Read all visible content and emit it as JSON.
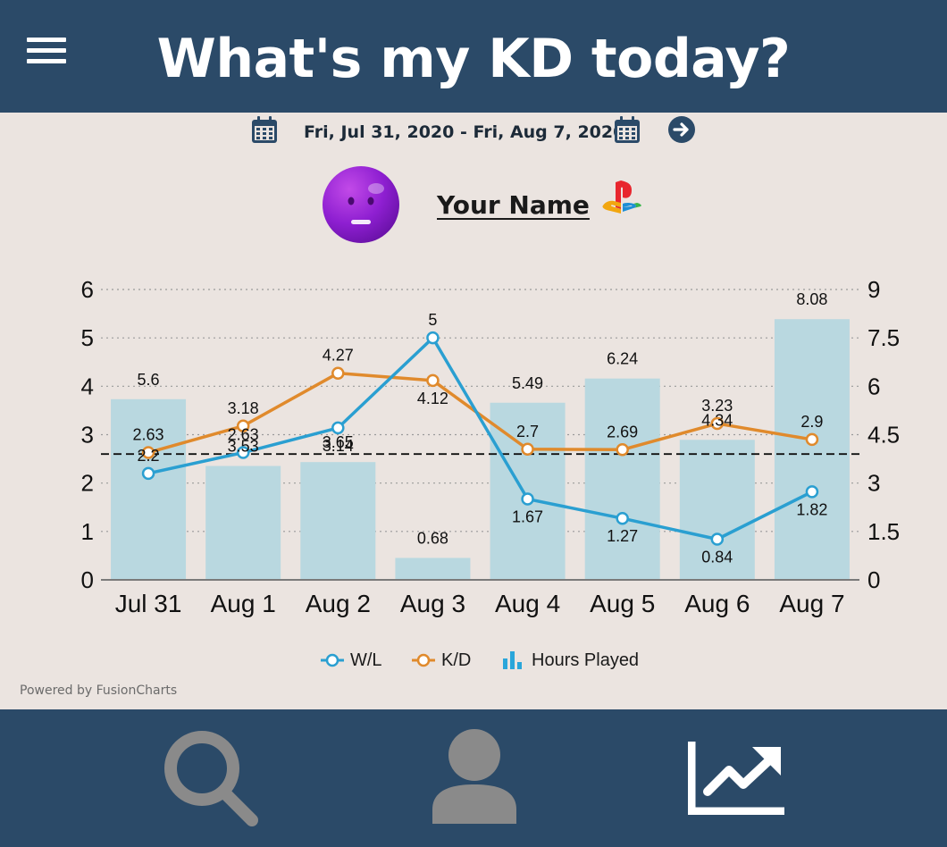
{
  "header": {
    "title": "What's my KD today?",
    "menu_icon": "hamburger-menu-icon"
  },
  "date_range": {
    "label": "Fri, Jul 31, 2020 - Fri, Aug 7, 2020",
    "start_icon": "calendar-icon",
    "end_icon": "calendar-icon",
    "next_icon": "arrow-right-circle-icon"
  },
  "profile": {
    "name": "Your Name",
    "avatar_icon": "neutral-face-avatar",
    "platform_icon": "playstation-logo-icon"
  },
  "chart_data": {
    "type": "combo",
    "categories": [
      "Jul 31",
      "Aug 1",
      "Aug 2",
      "Aug 3",
      "Aug 4",
      "Aug 5",
      "Aug 6",
      "Aug 7"
    ],
    "series": [
      {
        "name": "W/L",
        "type": "line",
        "axis": "left",
        "color": "#2a9fd1",
        "values": [
          2.2,
          2.63,
          3.14,
          5,
          1.67,
          1.27,
          0.84,
          1.82
        ]
      },
      {
        "name": "K/D",
        "type": "line",
        "axis": "left",
        "color": "#e08a2c",
        "values": [
          2.63,
          3.18,
          4.27,
          4.12,
          2.7,
          2.69,
          3.23,
          2.9
        ]
      },
      {
        "name": "Hours Played",
        "type": "bar",
        "axis": "right",
        "color": "#b9d8e0",
        "values": [
          5.6,
          3.53,
          3.65,
          0.68,
          5.49,
          6.24,
          4.34,
          8.08
        ]
      }
    ],
    "left_axis": {
      "min": 0,
      "max": 6,
      "ticks": [
        "0",
        "1",
        "2",
        "3",
        "4",
        "5",
        "6"
      ]
    },
    "right_axis": {
      "min": 0,
      "max": 9,
      "ticks": [
        "0",
        "1.5",
        "3",
        "4.5",
        "6",
        "7.5",
        "9"
      ]
    },
    "reference_line": {
      "axis": "left",
      "value": 2.6,
      "style": "dashed"
    },
    "grid": "dotted horizontal",
    "legend_position": "bottom-center"
  },
  "legend": [
    {
      "label": "W/L",
      "icon": "line-marker-icon",
      "color": "#2a9fd1"
    },
    {
      "label": "K/D",
      "icon": "line-marker-icon",
      "color": "#e08a2c"
    },
    {
      "label": "Hours Played",
      "icon": "bar-chart-icon",
      "color": "#2aa6da"
    }
  ],
  "footer": {
    "powered_by": "Powered by FusionCharts"
  },
  "bottom_nav": [
    {
      "name": "search",
      "icon": "search-icon",
      "active": false
    },
    {
      "name": "profile",
      "icon": "person-icon",
      "active": false
    },
    {
      "name": "stats",
      "icon": "trending-chart-icon",
      "active": true
    }
  ],
  "colors": {
    "header_bg": "#2b4a68",
    "page_bg": "#ebe4e0",
    "nav_inactive": "#8a8a8a",
    "nav_active": "#ffffff"
  }
}
